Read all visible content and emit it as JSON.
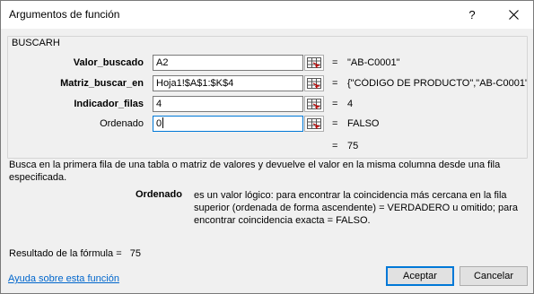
{
  "dialog": {
    "title": "Argumentos de función",
    "help_label": "?",
    "close_icon": "close-icon"
  },
  "function": {
    "name": "BUSCARH"
  },
  "arguments": [
    {
      "label": "Valor_buscado",
      "value": "A2",
      "equals": "=",
      "result": "\"AB-C0001\"",
      "bold": true
    },
    {
      "label": "Matriz_buscar_en",
      "value": "Hoja1!$A$1:$K$4",
      "equals": "=",
      "result": "{\"CÓDIGO DE PRODUCTO\",\"AB-C0001\"",
      "bold": true
    },
    {
      "label": "Indicador_filas",
      "value": "4",
      "equals": "=",
      "result": "4",
      "bold": true
    },
    {
      "label": "Ordenado",
      "value": "0",
      "equals": "=",
      "result": "FALSO",
      "bold": false
    }
  ],
  "function_result": {
    "equals": "=",
    "value": "75"
  },
  "description": "Busca en la primera fila de una tabla o matriz de valores y devuelve el valor en la misma columna desde una fila especificada.",
  "parameter_help": {
    "name": "Ordenado",
    "text": "es un valor lógico: para encontrar la coincidencia más cercana en la fila superior (ordenada de forma ascendente) = VERDADERO u omitido; para encontrar coincidencia exacta = FALSO."
  },
  "formula_result": {
    "label": "Resultado de la fórmula =",
    "value": "75"
  },
  "footer": {
    "help_link": "Ayuda sobre esta función",
    "ok_label": "Aceptar",
    "cancel_label": "Cancelar"
  },
  "colors": {
    "accent": "#0078d7",
    "link": "#0066cc",
    "background": "#f0f0f0"
  }
}
